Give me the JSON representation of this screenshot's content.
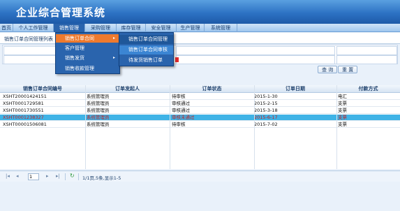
{
  "app": {
    "title": "企业综合管理系统"
  },
  "nav": {
    "items": [
      {
        "label": "首页"
      },
      {
        "label": "个人工作管理"
      },
      {
        "label": "销售管理"
      },
      {
        "label": "采购管理"
      },
      {
        "label": "库存管理"
      },
      {
        "label": "安全管理"
      },
      {
        "label": "生产管理"
      },
      {
        "label": "系统管理"
      }
    ]
  },
  "page": {
    "subtitle": "销售订单合同管理列表"
  },
  "toolbar": {
    "query_label": "查 询",
    "reset_label": "重 置"
  },
  "sales_menu": {
    "items": [
      {
        "label": "销售订单合同",
        "arrow": "▸"
      },
      {
        "label": "客户管理",
        "arrow": ""
      },
      {
        "label": "销售发货",
        "arrow": "▸"
      },
      {
        "label": "销售收款管理",
        "arrow": ""
      }
    ]
  },
  "contract_submenu": {
    "items": [
      {
        "label": "销售订单合同管理"
      },
      {
        "label": "销售订单合同审核"
      },
      {
        "label": "待发货销售订单"
      }
    ]
  },
  "table": {
    "columns": [
      "销售订单合同编号",
      "订单发起人",
      "订单状态",
      "订单日期",
      "付款方式"
    ],
    "rows": [
      [
        "XSHT20001424151",
        "系统管理员",
        "待审核",
        "2015-1-30",
        "电汇"
      ],
      [
        "XSHT0001729581",
        "系统管理员",
        "审核通过",
        "2015-2-15",
        "支票"
      ],
      [
        "XSHT0001730551",
        "系统管理员",
        "审核通过",
        "2015-3-18",
        "支票"
      ],
      [
        "XSHT0001238327",
        "系统管理员",
        "审核未通过",
        "2015-6-17",
        "支票"
      ],
      [
        "XSHT00001506081",
        "系统管理员",
        "待审核",
        "2015-7-02",
        "支票"
      ]
    ],
    "selected_row": 3
  },
  "pager": {
    "first_icon": "first-page-icon",
    "prev_icon": "prev-page-icon",
    "page_value": "1",
    "next_icon": "next-page-icon",
    "last_icon": "last-page-icon",
    "refresh_icon": "refresh-icon",
    "info": "1/1页,5条,显示1-5"
  },
  "colors": {
    "header": "#2d72c4",
    "menu": "#2a64ad",
    "menu_highlight": "#ee7a2e",
    "selected_row": "#3fb3e6"
  }
}
